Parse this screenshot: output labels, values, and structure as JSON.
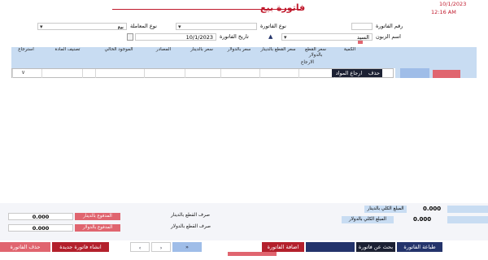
{
  "window": {
    "title": "فاتورة بيع",
    "date": "10/1/2023",
    "time": "12:16 AM"
  },
  "header_form": {
    "invoice_no_label": "رقم الفاتورة",
    "invoice_type_label": "نوع الفاتورة",
    "transaction_type_label": "نوع المعاملة",
    "transaction_type_value": "بيع",
    "customer_name_label": "اسم الزبون",
    "customer_name_value": "السيد",
    "invoice_date_label": "تاريخ الفاتورة",
    "invoice_date_value": "10/1/2023"
  },
  "grid": {
    "columns": [
      "الكمية",
      "سعر القطع بالدولار",
      "سعر القطع بالدينار",
      "سعر بالدولار",
      "سعر بالدينار",
      "المصادر",
      "الموجود الحالي",
      "تصنيف المادة",
      "استرجاع"
    ],
    "sub_column": "الارجاع",
    "delete_label": "حذف",
    "return_material_label": "ارجاع المواد"
  },
  "totals": {
    "total_dinar_label": "المبلغ الكلي بالدينار",
    "total_dinar_value": "0.000",
    "total_dollar_label": "المبلغ الكلي بالدولار",
    "total_dollar_value": "0.000",
    "exchange_dinar_label": "صرف القطع بالدينار",
    "exchange_dollar_label": "صرف القطع بالدولار",
    "paid_dinar_label": "المدفوع بالدينار",
    "paid_dinar_value": "0.000",
    "paid_dollar_label": "المدفوع بالدولار",
    "paid_dollar_value": "0.000"
  },
  "actions": {
    "print_label": "طباعة الفاتورة",
    "search_label": "بحث عن فاتورة",
    "save_label": "اضافة الفاتورة",
    "new_label": "انشاء فاتورة جديدة",
    "delete_label": "حذف الفاتورة",
    "nav_first": "«",
    "nav_prev": "‹",
    "nav_next": "›",
    "nav_last": "»"
  },
  "colors": {
    "title_red": "#c0192c",
    "grid_header_blue": "#c8dcf2",
    "accent_red": "#e0656f",
    "dark_red": "#b3202c",
    "navy": "#24346b",
    "dark_navy": "#1c2133",
    "light_blue": "#9fbde8"
  }
}
